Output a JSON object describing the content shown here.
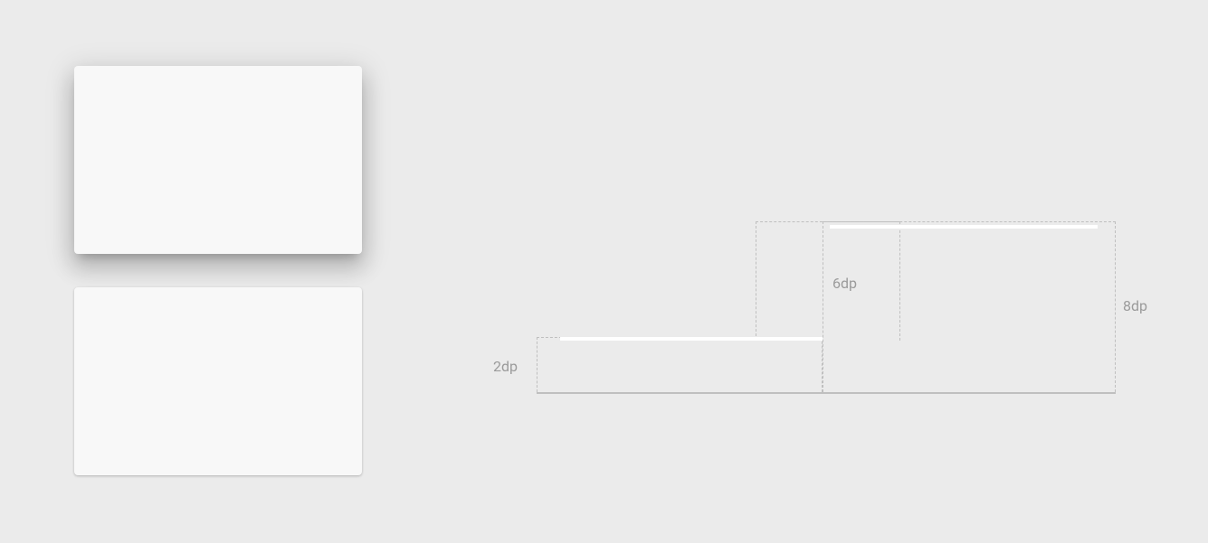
{
  "diagram": {
    "labels": {
      "small": "2dp",
      "medium": "6dp",
      "large": "8dp"
    }
  }
}
